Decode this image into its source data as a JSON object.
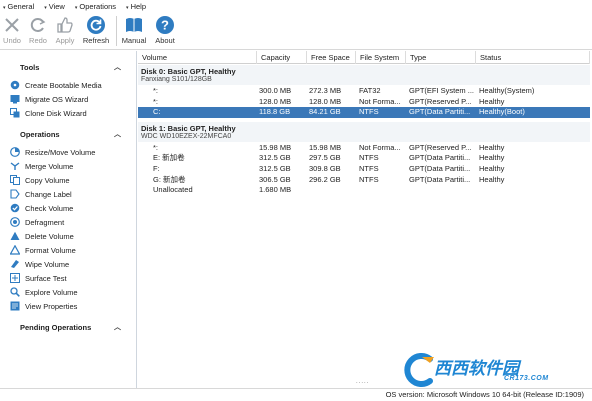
{
  "menu": [
    {
      "label": "General"
    },
    {
      "label": "View"
    },
    {
      "label": "Operations"
    },
    {
      "label": "Help"
    }
  ],
  "toolbar": {
    "undo": "Undo",
    "redo": "Redo",
    "apply": "Apply",
    "refresh": "Refresh",
    "manual": "Manual",
    "about": "About"
  },
  "sidebar": {
    "tools_title": "Tools",
    "tools": [
      {
        "label": "Create Bootable Media",
        "icon": "bootable-media-icon"
      },
      {
        "label": "Migrate OS Wizard",
        "icon": "migrate-os-icon"
      },
      {
        "label": "Clone Disk Wizard",
        "icon": "clone-disk-icon"
      }
    ],
    "operations_title": "Operations",
    "operations": [
      {
        "label": "Resize/Move Volume",
        "icon": "resize-icon"
      },
      {
        "label": "Merge Volume",
        "icon": "merge-icon"
      },
      {
        "label": "Copy Volume",
        "icon": "copy-icon"
      },
      {
        "label": "Change Label",
        "icon": "label-icon"
      },
      {
        "label": "Check Volume",
        "icon": "check-icon"
      },
      {
        "label": "Defragment",
        "icon": "defrag-icon"
      },
      {
        "label": "Delete Volume",
        "icon": "delete-icon"
      },
      {
        "label": "Format Volume",
        "icon": "format-icon"
      },
      {
        "label": "Wipe Volume",
        "icon": "wipe-icon"
      },
      {
        "label": "Surface Test",
        "icon": "surface-test-icon"
      },
      {
        "label": "Explore Volume",
        "icon": "explore-icon"
      },
      {
        "label": "View Properties",
        "icon": "properties-icon"
      }
    ],
    "pending_title": "Pending Operations"
  },
  "table": {
    "columns": [
      "Volume",
      "Capacity",
      "Free Space",
      "File System",
      "Type",
      "Status"
    ],
    "disks": [
      {
        "title": "Disk 0: Basic GPT, Healthy",
        "subtitle": "Fanxiang S101/128GB",
        "partitions": [
          {
            "volume": "*:",
            "capacity": "300.0 MB",
            "free": "272.3 MB",
            "fs": "FAT32",
            "type": "GPT(EFI System ...",
            "status": "Healthy(System)",
            "selected": false
          },
          {
            "volume": "*:",
            "capacity": "128.0 MB",
            "free": "128.0 MB",
            "fs": "Not Forma...",
            "type": "GPT(Reserved P...",
            "status": "Healthy",
            "selected": false
          },
          {
            "volume": "C:",
            "capacity": "118.8 GB",
            "free": "84.21 GB",
            "fs": "NTFS",
            "type": "GPT(Data Partiti...",
            "status": "Healthy(Boot)",
            "selected": true
          }
        ]
      },
      {
        "title": "Disk 1: Basic GPT, Healthy",
        "subtitle": "WDC WD10EZEX-22MFCA0",
        "partitions": [
          {
            "volume": "*:",
            "capacity": "15.98 MB",
            "free": "15.98 MB",
            "fs": "Not Forma...",
            "type": "GPT(Reserved P...",
            "status": "Healthy",
            "selected": false
          },
          {
            "volume": "E: 新加卷",
            "capacity": "312.5 GB",
            "free": "297.5 GB",
            "fs": "NTFS",
            "type": "GPT(Data Partiti...",
            "status": "Healthy",
            "selected": false
          },
          {
            "volume": "F:",
            "capacity": "312.5 GB",
            "free": "309.8 GB",
            "fs": "NTFS",
            "type": "GPT(Data Partiti...",
            "status": "Healthy",
            "selected": false
          },
          {
            "volume": "G: 新加卷",
            "capacity": "306.5 GB",
            "free": "296.2 GB",
            "fs": "NTFS",
            "type": "GPT(Data Partiti...",
            "status": "Healthy",
            "selected": false
          },
          {
            "volume": "Unallocated",
            "capacity": "1.680 MB",
            "free": "",
            "fs": "",
            "type": "",
            "status": "",
            "selected": false
          }
        ]
      }
    ],
    "scroll_indicator": "....."
  },
  "statusbar": {
    "text": "OS version: Microsoft Windows 10  64-bit  (Release ID:1909)"
  },
  "watermark": {
    "main": "西西软件园",
    "sub": "CR173.COM"
  },
  "colors": {
    "accent": "#3b78b8",
    "icon_blue": "#2f7cc1",
    "disk_header_bg": "#f2f5f8"
  }
}
